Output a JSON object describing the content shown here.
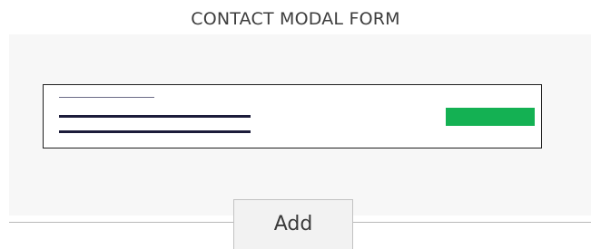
{
  "header": {
    "title": "CONTACT MODAL FORM"
  },
  "contact_card": {
    "accent_color": "#14b153",
    "line_color": "#1c1c3a"
  },
  "footer": {
    "add_label": "Add"
  }
}
